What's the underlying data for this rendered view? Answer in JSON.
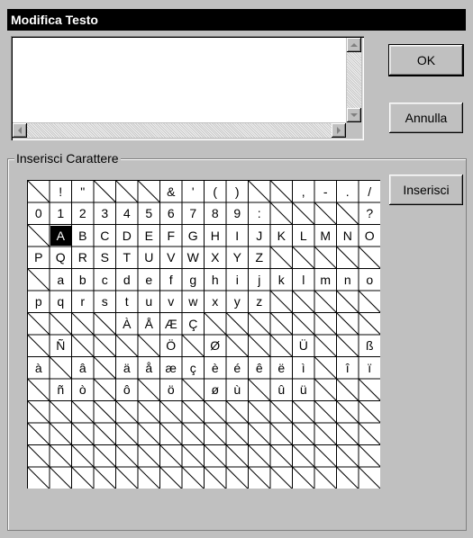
{
  "window": {
    "title": "Modifica Testo"
  },
  "buttons": {
    "ok": "OK",
    "cancel": "Annulla",
    "insert": "Inserisci"
  },
  "group": {
    "label": "Inserisci Carattere"
  },
  "charmap": {
    "selected": "A",
    "rows": [
      [
        "",
        "!",
        "\"",
        "",
        "",
        "",
        "&",
        "'",
        "(",
        ")",
        "",
        "",
        ",",
        "-",
        ".",
        "/"
      ],
      [
        "0",
        "1",
        "2",
        "3",
        "4",
        "5",
        "6",
        "7",
        "8",
        "9",
        ":",
        "",
        "",
        "",
        "",
        "?"
      ],
      [
        "",
        "A",
        "B",
        "C",
        "D",
        "E",
        "F",
        "G",
        "H",
        "I",
        "J",
        "K",
        "L",
        "M",
        "N",
        "O"
      ],
      [
        "P",
        "Q",
        "R",
        "S",
        "T",
        "U",
        "V",
        "W",
        "X",
        "Y",
        "Z",
        "",
        "",
        "",
        "",
        ""
      ],
      [
        "",
        "a",
        "b",
        "c",
        "d",
        "e",
        "f",
        "g",
        "h",
        "i",
        "j",
        "k",
        "l",
        "m",
        "n",
        "o"
      ],
      [
        "p",
        "q",
        "r",
        "s",
        "t",
        "u",
        "v",
        "w",
        "x",
        "y",
        "z",
        "",
        "",
        "",
        "",
        ""
      ],
      [
        "",
        "",
        "",
        "",
        "À",
        "Å",
        "Æ",
        "Ç",
        "",
        "",
        "",
        "",
        "",
        "",
        "",
        ""
      ],
      [
        "",
        "Ñ",
        "",
        "",
        "",
        "",
        "Ö",
        "",
        "Ø",
        "",
        "",
        "",
        "Ü",
        "",
        "",
        "ß"
      ],
      [
        "à",
        "",
        "â",
        "",
        "ä",
        "å",
        "æ",
        "ç",
        "è",
        "é",
        "ê",
        "ë",
        "ì",
        "",
        "î",
        "ï"
      ],
      [
        "",
        "ñ",
        "ò",
        "",
        "ô",
        "",
        "ö",
        "",
        "ø",
        "ù",
        "",
        "û",
        "ü",
        "",
        "",
        ""
      ],
      [
        "",
        "",
        "",
        "",
        "",
        "",
        "",
        "",
        "",
        "",
        "",
        "",
        "",
        "",
        "",
        ""
      ],
      [
        "",
        "",
        "",
        "",
        "",
        "",
        "",
        "",
        "",
        "",
        "",
        "",
        "",
        "",
        "",
        ""
      ],
      [
        "",
        "",
        "",
        "",
        "",
        "",
        "",
        "",
        "",
        "",
        "",
        "",
        "",
        "",
        "",
        ""
      ],
      [
        "",
        "",
        "",
        "",
        "",
        "",
        "",
        "",
        "",
        "",
        "",
        "",
        "",
        "",
        "",
        ""
      ]
    ]
  }
}
